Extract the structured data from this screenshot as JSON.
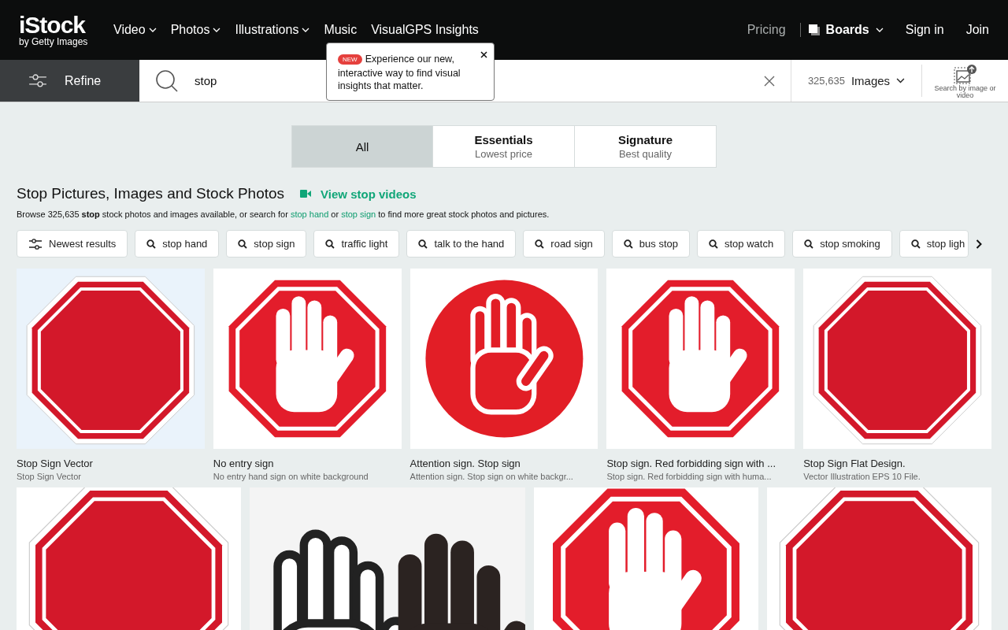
{
  "logo": {
    "name": "iStock",
    "tagline": "by Getty Images"
  },
  "nav": [
    {
      "label": "Video",
      "dropdown": true
    },
    {
      "label": "Photos",
      "dropdown": true
    },
    {
      "label": "Illustrations",
      "dropdown": true
    },
    {
      "label": "Music",
      "dropdown": false
    },
    {
      "label": "VisualGPS Insights",
      "dropdown": false
    }
  ],
  "nav_right": {
    "pricing": "Pricing",
    "boards": "Boards",
    "sign_in": "Sign in",
    "join": "Join"
  },
  "popup": {
    "badge": "NEW",
    "text": "Experience our new, interactive way to find visual insights that matter."
  },
  "refine": "Refine",
  "search": {
    "value": "stop"
  },
  "count": "325,635",
  "media_type": "Images",
  "search_by_image": "Search by image or video",
  "tabs": [
    {
      "label": "All",
      "selected": true
    },
    {
      "label": "Essentials",
      "sub": "Lowest price",
      "selected": false
    },
    {
      "label": "Signature",
      "sub": "Best quality",
      "selected": false
    }
  ],
  "heading": "Stop Pictures, Images and Stock Photos",
  "video_link": "View stop videos",
  "description": [
    {
      "kind": "text",
      "text": "Browse 325,635 **stop** stock photos and images available, or search for "
    },
    {
      "kind": "link",
      "text": "stop hand"
    },
    {
      "kind": "text",
      "text": " or "
    },
    {
      "kind": "link",
      "text": "stop sign"
    },
    {
      "kind": "text",
      "text": " to find more great stock photos and pictures."
    }
  ],
  "filters": [
    {
      "label": "Newest results",
      "kind": "sort"
    },
    {
      "label": "stop hand",
      "kind": "search"
    },
    {
      "label": "stop sign",
      "kind": "search"
    },
    {
      "label": "traffic light",
      "kind": "search"
    },
    {
      "label": "talk to the hand",
      "kind": "search"
    },
    {
      "label": "road sign",
      "kind": "search"
    },
    {
      "label": "bus stop",
      "kind": "search"
    },
    {
      "label": "stop watch",
      "kind": "search"
    },
    {
      "label": "stop smoking",
      "kind": "search"
    },
    {
      "label": "stop ligh",
      "kind": "search"
    }
  ],
  "results": [
    {
      "title": "Stop Sign Vector",
      "subtitle": "Stop Sign Vector"
    },
    {
      "title": "No entry sign",
      "subtitle": "No entry hand sign on white background"
    },
    {
      "title": "Attention sign. Stop sign",
      "subtitle": "Attention sign. Stop sign on white backgr..."
    },
    {
      "title": "Stop sign. Red forbidding sign with ...",
      "subtitle": "Stop sign. Red forbidding sign with huma..."
    },
    {
      "title": "Stop Sign Flat Design.",
      "subtitle": "Vector Illustration EPS 10 File."
    }
  ]
}
